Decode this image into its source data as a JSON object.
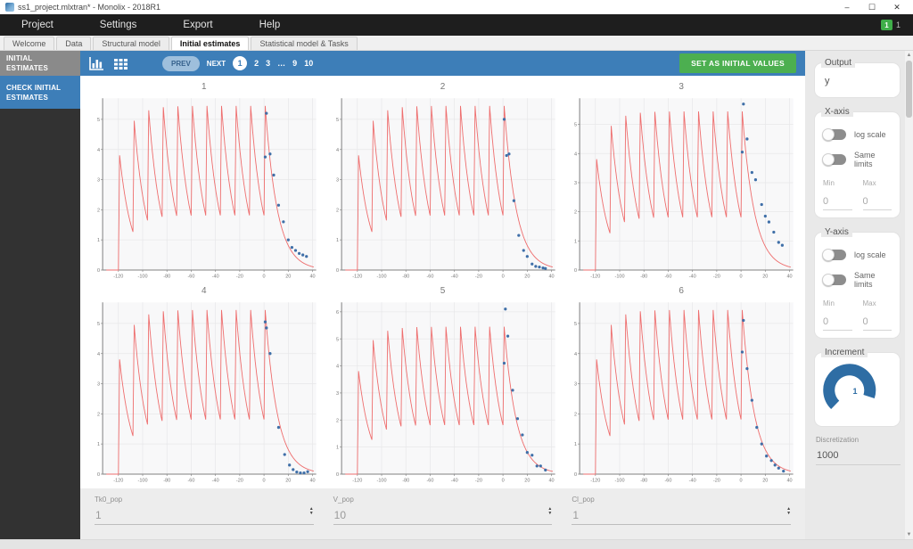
{
  "colors": {
    "accent_blue": "#3d7eb8",
    "green": "#4caf50",
    "curve_red": "#ee6e6e",
    "point_blue": "#3f6fa8",
    "dial_blue": "#2e6da4",
    "sidebar_dark": "#323232"
  },
  "window": {
    "title": "ss1_project.mlxtran* - Monolix - 2018R1",
    "minimize": "–",
    "maximize": "☐",
    "close": "✕"
  },
  "menubar": {
    "items": [
      "Project",
      "Settings",
      "Export",
      "Help"
    ],
    "notification_badge": "1",
    "notification_count": "1"
  },
  "tabs": [
    {
      "label": "Welcome"
    },
    {
      "label": "Data"
    },
    {
      "label": "Structural model"
    },
    {
      "label": "Initial estimates",
      "active": true
    },
    {
      "label": "Statistical model & Tasks"
    }
  ],
  "sidebar": {
    "items": [
      {
        "label": "INITIAL ESTIMATES"
      },
      {
        "label": "CHECK INITIAL ESTIMATES"
      }
    ]
  },
  "toolbar": {
    "icons": [
      "chart-icon",
      "grid-icon"
    ],
    "prev": "PREV",
    "next": "NEXT",
    "pages": [
      "1",
      "2",
      "3",
      "…",
      "9",
      "10"
    ],
    "active_page": "1",
    "set_button": "SET AS INITIAL VALUES"
  },
  "params": [
    {
      "label": "Tk0_pop",
      "value": "1"
    },
    {
      "label": "V_pop",
      "value": "10"
    },
    {
      "label": "Cl_pop",
      "value": "1"
    }
  ],
  "panel": {
    "output": {
      "label": "Output",
      "value": "y"
    },
    "xaxis": {
      "label": "X-axis",
      "log_scale": "log scale",
      "same_limits": "Same limits",
      "min_label": "Min",
      "max_label": "Max",
      "min": "0",
      "max": "0"
    },
    "yaxis": {
      "label": "Y-axis",
      "log_scale": "log scale",
      "same_limits": "Same limits",
      "min_label": "Min",
      "max_label": "Max",
      "min": "0",
      "max": "0"
    },
    "increment": {
      "label": "Increment",
      "value": "1"
    },
    "discretization": {
      "label": "Discretization",
      "value": "1000"
    }
  },
  "chart_data": {
    "type": "line",
    "description": "Check initial estimates: population prediction curve (red) with individual observations (blue points) for subjects 1-6",
    "x_ticks": [
      -120,
      -100,
      -80,
      -60,
      -40,
      -20,
      0,
      20,
      40
    ],
    "x_range": [
      -133,
      43
    ],
    "curve_model": {
      "dose_start": -120,
      "dose_interval": 12,
      "dose_count": 11,
      "infusion_duration": 1,
      "elimination_rate": 0.1,
      "amplitude": 40
    },
    "subplots": [
      {
        "title": "1",
        "ylim": [
          0,
          5.7
        ],
        "points": [
          [
            1,
            3.75
          ],
          [
            2,
            5.2
          ],
          [
            5,
            3.85
          ],
          [
            8,
            3.15
          ],
          [
            12,
            2.15
          ],
          [
            16,
            1.6
          ],
          [
            20,
            1.0
          ],
          [
            23,
            0.75
          ],
          [
            26,
            0.65
          ],
          [
            29,
            0.55
          ],
          [
            32,
            0.5
          ],
          [
            35,
            0.45
          ]
        ]
      },
      {
        "title": "2",
        "ylim": [
          0,
          5.7
        ],
        "points": [
          [
            1,
            5.0
          ],
          [
            3,
            3.8
          ],
          [
            5,
            3.85
          ],
          [
            9,
            2.3
          ],
          [
            13,
            1.15
          ],
          [
            17,
            0.65
          ],
          [
            20,
            0.45
          ],
          [
            24,
            0.2
          ],
          [
            27,
            0.12
          ],
          [
            30,
            0.1
          ],
          [
            33,
            0.07
          ],
          [
            35,
            0.05
          ]
        ]
      },
      {
        "title": "3",
        "ylim": [
          0,
          5.9
        ],
        "points": [
          [
            1,
            4.05
          ],
          [
            2,
            5.7
          ],
          [
            5,
            4.5
          ],
          [
            9,
            3.35
          ],
          [
            12,
            3.1
          ],
          [
            17,
            2.25
          ],
          [
            20,
            1.85
          ],
          [
            23,
            1.65
          ],
          [
            27,
            1.3
          ],
          [
            31,
            0.95
          ],
          [
            34,
            0.85
          ]
        ]
      },
      {
        "title": "4",
        "ylim": [
          0,
          5.7
        ],
        "points": [
          [
            1,
            5.05
          ],
          [
            2,
            4.85
          ],
          [
            5,
            4.0
          ],
          [
            12,
            1.55
          ],
          [
            17,
            0.65
          ],
          [
            21,
            0.3
          ],
          [
            24,
            0.15
          ],
          [
            27,
            0.07
          ],
          [
            30,
            0.04
          ],
          [
            33,
            0.04
          ],
          [
            36,
            0.08
          ]
        ]
      },
      {
        "title": "5",
        "ylim": [
          0,
          6.35
        ],
        "points": [
          [
            1,
            4.1
          ],
          [
            2,
            6.1
          ],
          [
            4,
            5.1
          ],
          [
            8,
            3.1
          ],
          [
            12,
            2.05
          ],
          [
            16,
            1.45
          ],
          [
            20,
            0.8
          ],
          [
            24,
            0.7
          ],
          [
            28,
            0.3
          ],
          [
            31,
            0.3
          ],
          [
            35,
            0.15
          ]
        ]
      },
      {
        "title": "6",
        "ylim": [
          0,
          5.7
        ],
        "points": [
          [
            1,
            4.05
          ],
          [
            2,
            5.1
          ],
          [
            5,
            3.5
          ],
          [
            9,
            2.45
          ],
          [
            13,
            1.55
          ],
          [
            17,
            1.0
          ],
          [
            21,
            0.6
          ],
          [
            25,
            0.45
          ],
          [
            28,
            0.3
          ],
          [
            31,
            0.2
          ],
          [
            35,
            0.1
          ]
        ]
      }
    ]
  }
}
